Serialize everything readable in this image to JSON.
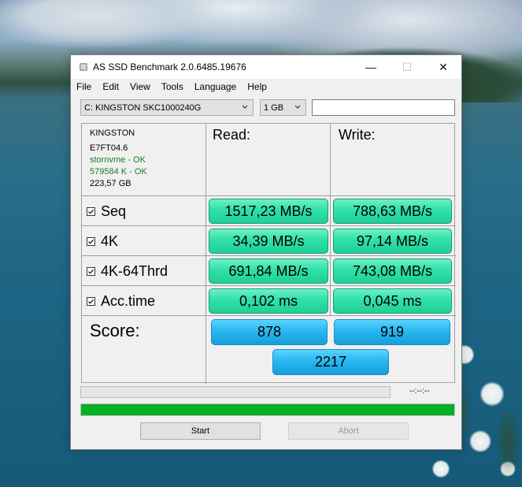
{
  "window": {
    "title": "AS SSD Benchmark 2.0.6485.19676",
    "menu": [
      "File",
      "Edit",
      "View",
      "Tools",
      "Language",
      "Help"
    ]
  },
  "controls": {
    "drive_select": "C: KINGSTON SKC1000240G",
    "size_select": "1 GB",
    "text_field_value": ""
  },
  "drive_info": {
    "model": "KINGSTON",
    "firmware": "E7FT04.6",
    "driver": "stornvme - OK",
    "alignment": "579584 K - OK",
    "capacity": "223,57 GB"
  },
  "results": {
    "read_header": "Read:",
    "write_header": "Write:",
    "rows": [
      {
        "label": "Seq",
        "read": "1517,23 MB/s",
        "write": "788,63 MB/s"
      },
      {
        "label": "4K",
        "read": "34,39 MB/s",
        "write": "97,14 MB/s"
      },
      {
        "label": "4K-64Thrd",
        "read": "691,84 MB/s",
        "write": "743,08 MB/s"
      },
      {
        "label": "Acc.time",
        "read": "0,102 ms",
        "write": "0,045 ms"
      }
    ],
    "score_label": "Score:",
    "score_read": "878",
    "score_write": "919",
    "score_total": "2217"
  },
  "progress": {
    "time": "--:--:--",
    "overall_fill_fraction": 1.0
  },
  "buttons": {
    "start": "Start",
    "abort": "Abort"
  },
  "colors": {
    "result_green": "#2fe0a8",
    "score_blue": "#28b8f0",
    "ok_text": "#1b7c2a",
    "progress_green": "#06b025"
  },
  "icons": {
    "app": "ssd-drive-icon",
    "checkbox": "checkmark-icon"
  }
}
